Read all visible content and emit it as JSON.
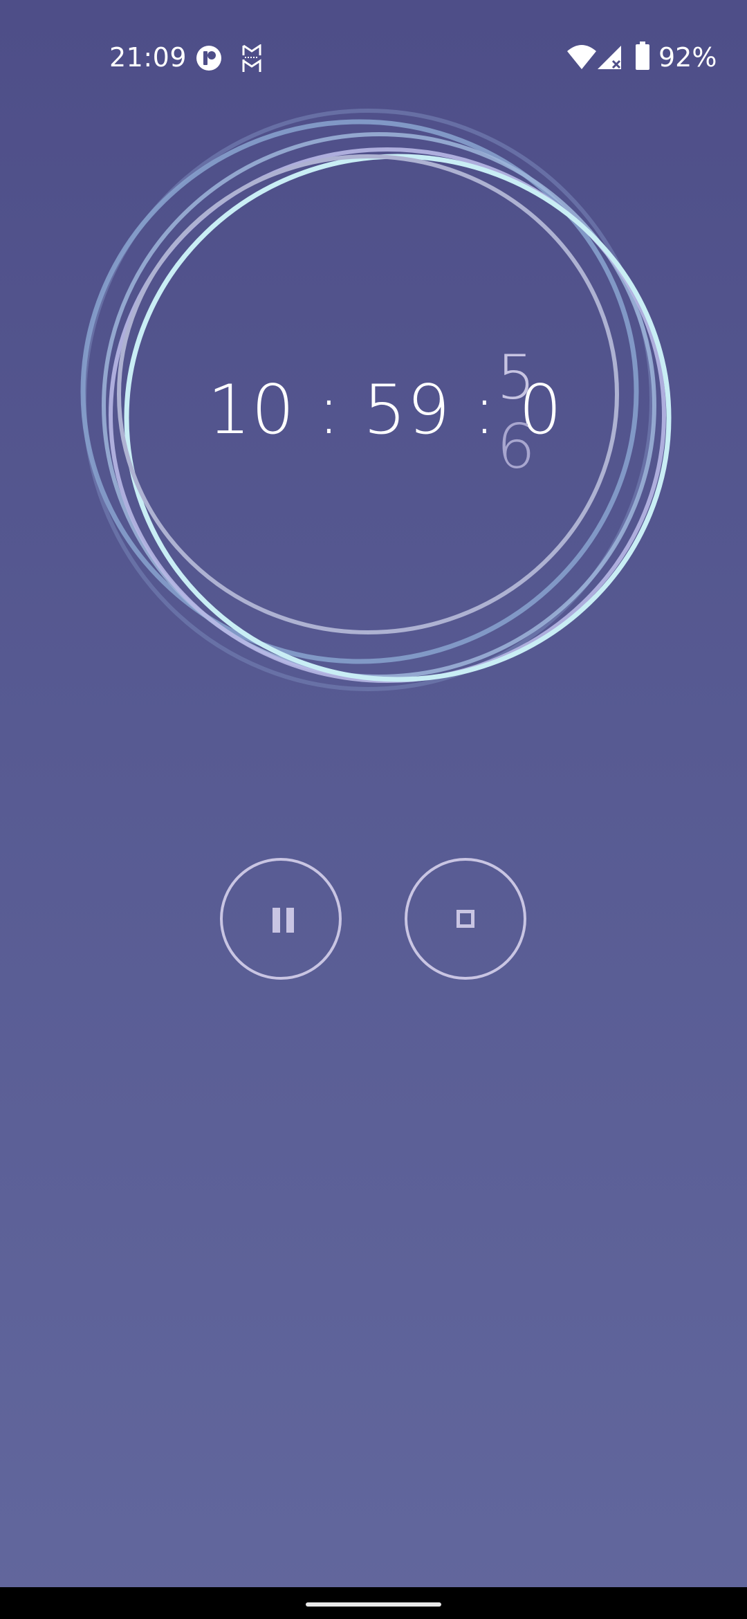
{
  "status_bar": {
    "time": "21:09",
    "battery_percent": "92%",
    "icons": [
      "notification-app-icon",
      "gmail-style-icon",
      "wifi-icon",
      "cellular-signal-icon",
      "battery-icon"
    ]
  },
  "timer": {
    "main": "10 : 59 : 0",
    "last_digit_current": "5",
    "last_digit_next": "6"
  },
  "controls": {
    "pause_icon": "pause-icon",
    "stop_icon": "stop-icon"
  },
  "colors": {
    "background_top": "#4e4e88",
    "background_bottom": "#62679d",
    "control_outline": "#c9c5e3"
  }
}
